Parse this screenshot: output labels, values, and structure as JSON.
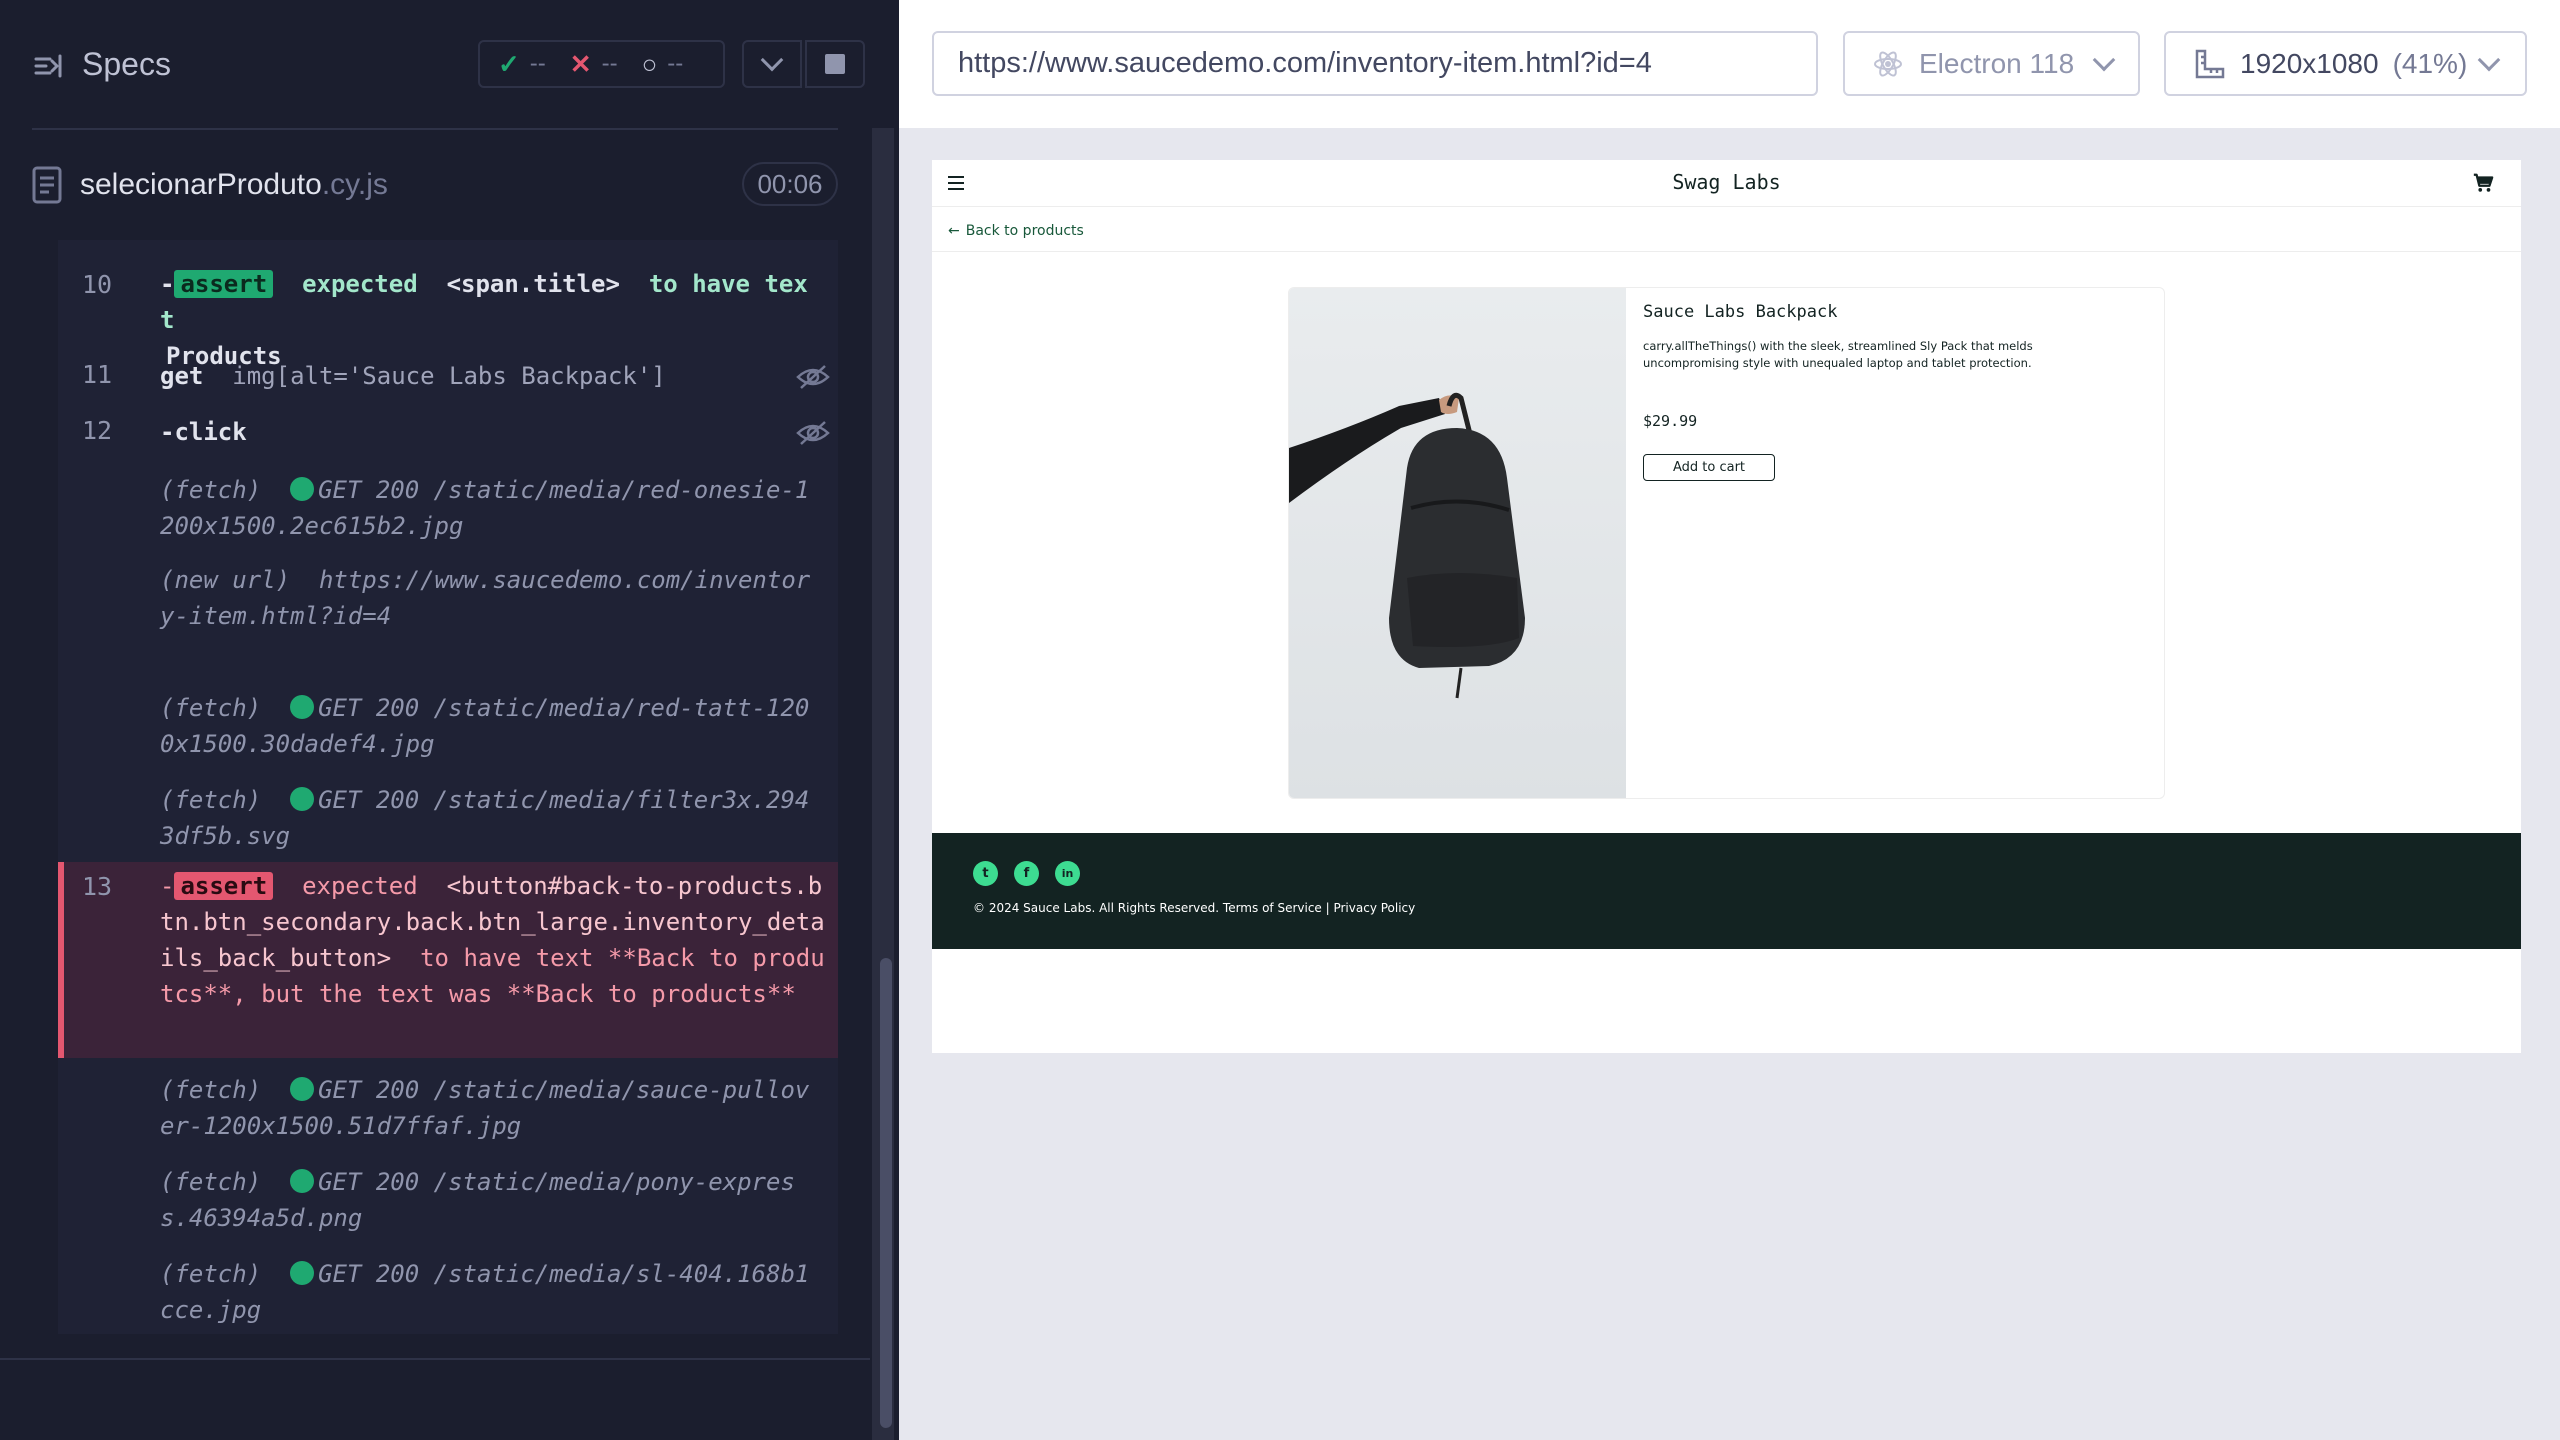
{
  "reporter": {
    "specs_label": "Specs",
    "stats": {
      "passed": "--",
      "failed": "--",
      "pending": "--"
    },
    "spec": {
      "name": "selecionarProduto",
      "ext": ".cy.js",
      "duration": "00:06"
    },
    "commands": [
      {
        "num": "10",
        "type": "assert-pass",
        "badge": "assert",
        "text_a": "expected",
        "text_b": "<span.title>",
        "text_c": "to have text",
        "text_d": "Products"
      },
      {
        "num": "11",
        "name": "get",
        "message": "img[alt='Sauce Labs Backpack']"
      },
      {
        "num": "12",
        "name": "-click",
        "message": ""
      },
      {
        "fetch": "(fetch)",
        "request": "GET 200 /static/media/red-onesie-1200x1500.2ec615b2.jpg"
      },
      {
        "new_url_label": "(new url)",
        "url": "https://www.saucedemo.com/inventory-item.html?id=4"
      },
      {
        "fetch": "(fetch)",
        "request": "GET 200 /static/media/red-tatt-1200x1500.30dadef4.jpg"
      },
      {
        "fetch": "(fetch)",
        "request": "GET 200 /static/media/filter3x.2943df5b.svg"
      },
      {
        "num": "13",
        "type": "assert-fail",
        "badge": "assert",
        "text_a": "expected",
        "text_b": "<button#back-to-products.btn.btn_secondary.back.btn_large.inventory_details_back_button>",
        "text_c": "to have text **Back to produtcs**, but the text was **Back to products**"
      },
      {
        "fetch": "(fetch)",
        "request": "GET 200 /static/media/sauce-pullover-1200x1500.51d7ffaf.jpg"
      },
      {
        "fetch": "(fetch)",
        "request": "GET 200 /static/media/pony-express.46394a5d.png"
      },
      {
        "fetch": "(fetch)",
        "request": "GET 200 /static/media/sl-404.168b1cce.jpg"
      }
    ]
  },
  "aut": {
    "url": "https://www.saucedemo.com/inventory-item.html?id=4",
    "browser": "Electron 118",
    "viewport": "1920x1080",
    "viewport_scale": "(41%)"
  },
  "app": {
    "logo": "Swag Labs",
    "back_link": "Back to products",
    "product": {
      "name": "Sauce Labs Backpack",
      "description": "carry.allTheThings() with the sleek, streamlined Sly Pack that melds uncompromising style with unequaled laptop and tablet protection.",
      "price": "$29.99",
      "add_button": "Add to cart"
    },
    "footer": {
      "copyright": "© 2024 Sauce Labs. All Rights Reserved. Terms of Service | Privacy Policy",
      "social": [
        "twitter-icon",
        "facebook-icon",
        "linkedin-icon"
      ]
    }
  },
  "colors": {
    "pass": "#1fa971",
    "fail": "#e45770",
    "swag_dark": "#132322",
    "swag_accent": "#3ddc91"
  }
}
